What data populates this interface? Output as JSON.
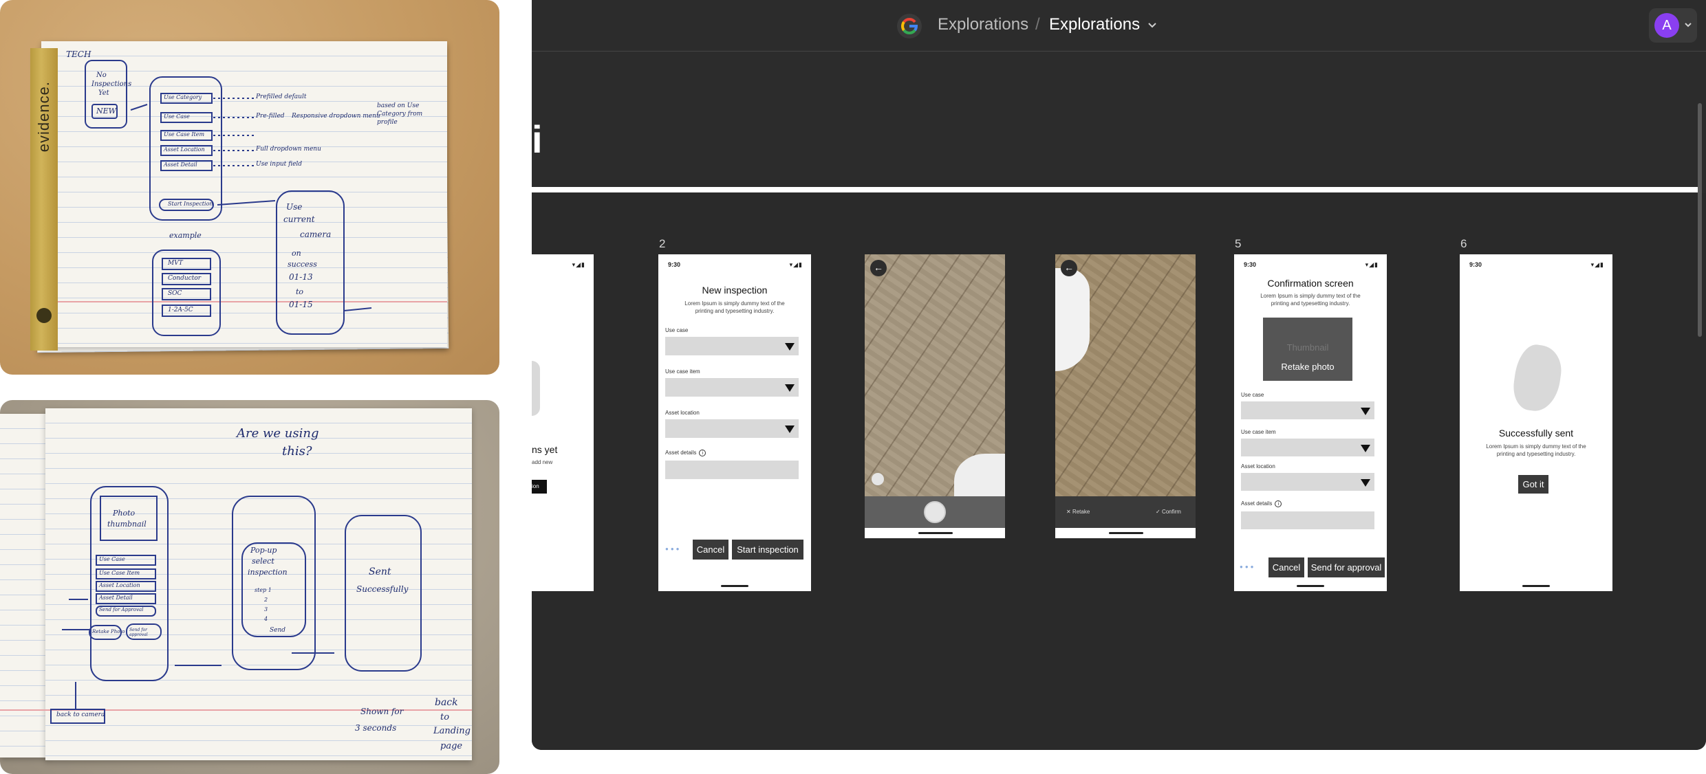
{
  "sketch1": {
    "spine_text": "evidence.",
    "notes": {
      "top_left": "TECH",
      "no_insp_line1": "No",
      "no_insp_line2": "Inspections",
      "no_insp_line3": "Yet",
      "new_button": "NEW",
      "field1": "Use Category",
      "field2": "Use Case",
      "field3": "Use Case Item",
      "field4": "Asset Location",
      "field5": "Asset Detail",
      "start_btn": "Start Inspection",
      "note1": "Prefilled default",
      "note2": "Pre-filled",
      "note3": "Responsive dropdown menu",
      "note4": "Full dropdown menu",
      "note5": "Use input field",
      "note6": "based on Use Category from profile",
      "example": "example",
      "ex1": "MVT",
      "ex2": "Conductor",
      "ex3": "SOC",
      "ex4": "1-2A-5C",
      "camera_line1": "Use",
      "camera_line2": "current",
      "camera_line3": "camera",
      "camera_line4": "on",
      "camera_line5": "success",
      "camera_line6": "01-13",
      "camera_line7": "to",
      "camera_line8": "01-15"
    }
  },
  "sketch2": {
    "question_line1": "Are we using",
    "question_line2": "this?",
    "photo_thumb_line1": "Photo",
    "photo_thumb_line2": "thumbnail",
    "field1": "Use Case",
    "field2": "Use Case Item",
    "field3": "Asset Location",
    "field4": "Asset Detail",
    "send_btn": "Send for Approval",
    "retake": "Retake Photo",
    "send_approval": "Send for approval",
    "popup_line1": "Pop-up",
    "popup_line2": "select",
    "popup_line3": "inspection",
    "step1": "step 1",
    "step2": "2",
    "step3": "3",
    "step4": "4",
    "send": "Send",
    "sent_line1": "Sent",
    "sent_line2": "Successfully",
    "back_camera": "back to camera",
    "shown_for_line1": "Shown for",
    "shown_for_line2": "3 seconds",
    "back_landing_line1": "back",
    "back_landing_line2": "to",
    "back_landing_line3": "Landing",
    "back_landing_line4": "page"
  },
  "app": {
    "breadcrumb_parent": "Explorations",
    "breadcrumb_separator": "/",
    "breadcrumb_current": "Explorations",
    "avatar_initial": "A",
    "title_fragment": "i",
    "frames": {
      "frame1": {
        "partial_text": "ns yet",
        "partial_sub": "add new",
        "partial_btn": "ion"
      },
      "frame2": {
        "number": "2",
        "time": "9:30",
        "title": "New inspection",
        "subtitle": "Lorem Ipsum is simply dummy text of the printing and typesetting industry.",
        "label_use_case": "Use case",
        "label_use_case_item": "Use case item",
        "label_asset_location": "Asset location",
        "label_asset_details": "Asset details",
        "info_icon": "i",
        "cancel": "Cancel",
        "start": "Start inspection"
      },
      "frame3": {
        "back_icon": "←"
      },
      "frame4": {
        "back_icon": "←",
        "retake": "Retake",
        "confirm": "Confirm"
      },
      "frame5": {
        "number": "5",
        "time": "9:30",
        "title": "Confirmation screen",
        "subtitle": "Lorem Ipsum is simply dummy text of the printing and typesetting industry.",
        "thumbnail": "Thumbnail",
        "retake_photo": "Retake photo",
        "label_use_case": "Use case",
        "label_use_case_item": "Use case item",
        "label_asset_location": "Asset location",
        "label_asset_details": "Asset details",
        "info_icon": "i",
        "cancel": "Cancel",
        "send": "Send for approval"
      },
      "frame6": {
        "number": "6",
        "time": "9:30",
        "title": "Successfully sent",
        "subtitle": "Lorem Ipsum is simply dummy text of the printing and typesetting industry.",
        "button": "Got it"
      }
    }
  }
}
